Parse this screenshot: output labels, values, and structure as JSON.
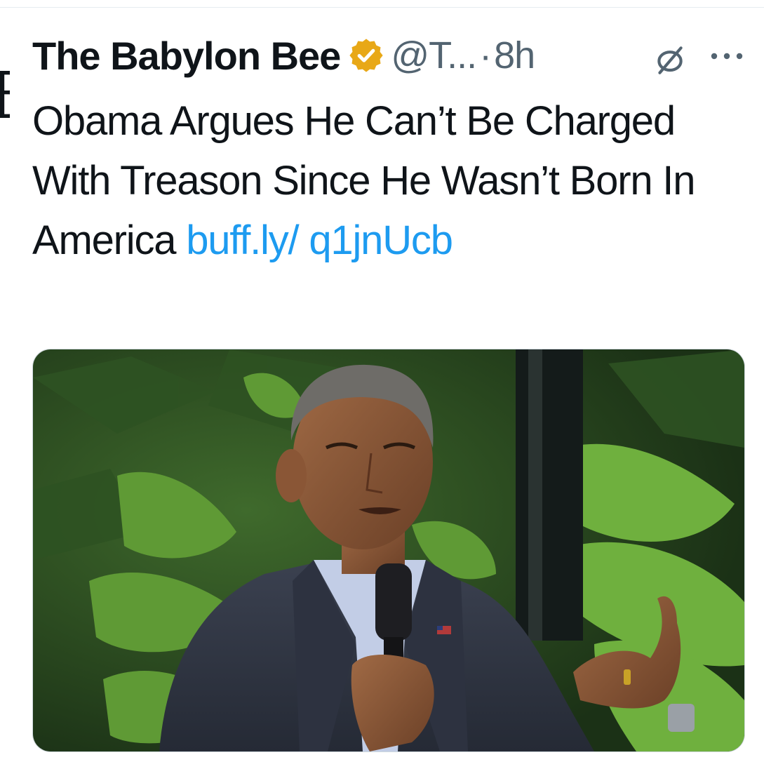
{
  "tweet": {
    "display_name": "The Babylon Bee",
    "handle": "@T...",
    "separator": "·",
    "timestamp": "8h",
    "text_main": "Obama Argues He Can’t Be Charged With Treason Since He Wasn’t Born In America ",
    "link_text": "buff.ly/ q1jnUcb",
    "verified_badge_color": "#E8A817",
    "link_color": "#1D9BF0"
  },
  "icons": {
    "verified": "verified-badge-icon",
    "mute": "mute-icon",
    "more": "more-options-icon"
  }
}
